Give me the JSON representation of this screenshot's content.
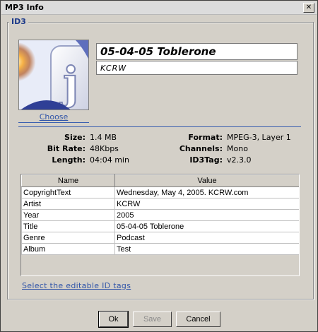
{
  "window": {
    "title": "MP3 Info",
    "close_glyph": "✕"
  },
  "group": {
    "legend": "ID3"
  },
  "artwork": {
    "choose_label": "Choose"
  },
  "track": {
    "title": "05-04-05 Toblerone",
    "artist": "KCRW"
  },
  "info": {
    "left": [
      {
        "label": "Size:",
        "value": "1.4 MB"
      },
      {
        "label": "Bit Rate:",
        "value": "48Kbps"
      },
      {
        "label": "Length:",
        "value": "04:04 min"
      }
    ],
    "right": [
      {
        "label": "Format:",
        "value": "MPEG-3, Layer 1"
      },
      {
        "label": "Channels:",
        "value": "Mono"
      },
      {
        "label": "ID3Tag:",
        "value": "v2.3.0"
      }
    ]
  },
  "table": {
    "columns": [
      "Name",
      "Value"
    ],
    "rows": [
      {
        "name": "CopyrightText",
        "value": "Wednesday, May 4, 2005.  KCRW.com"
      },
      {
        "name": "Artist",
        "value": "KCRW"
      },
      {
        "name": "Year",
        "value": "2005"
      },
      {
        "name": "Title",
        "value": "05-04-05 Toblerone"
      },
      {
        "name": "Genre",
        "value": "Podcast"
      },
      {
        "name": "Album",
        "value": "Test"
      }
    ]
  },
  "select_tags_label": "Select the editable ID tags",
  "buttons": {
    "ok": "Ok",
    "save": "Save",
    "cancel": "Cancel"
  },
  "colors": {
    "link": "#3155a8",
    "legend": "#1d3a8a",
    "dialog_bg": "#d4d0c8"
  }
}
